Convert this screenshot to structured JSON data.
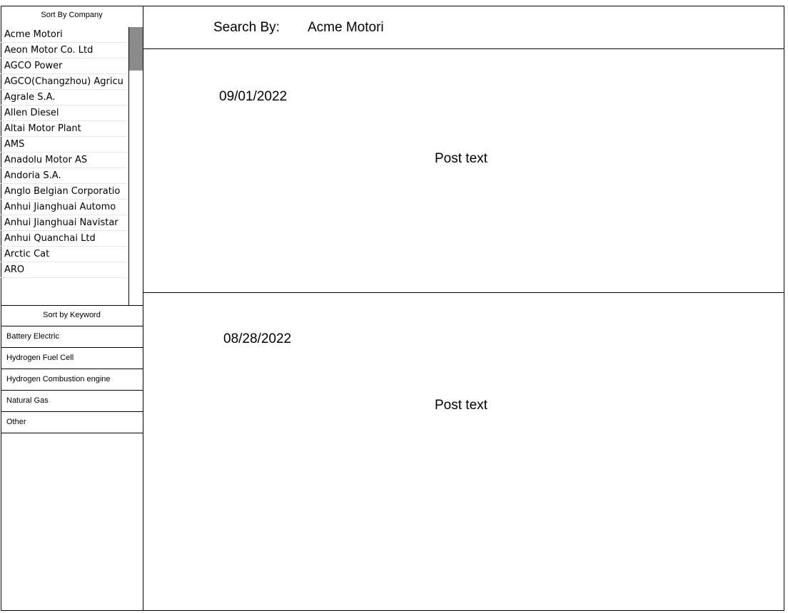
{
  "sidebar": {
    "company_header": "Sort By Company",
    "companies": [
      "Acme Motori",
      "Aeon Motor Co. Ltd",
      "AGCO  Power",
      "AGCO(Changzhou) Agricu",
      "Agrale S.A.",
      "Allen Diesel",
      "Altai Motor Plant",
      "AMS",
      "Anadolu Motor AS",
      "Andoria S.A.",
      "Anglo Belgian Corporatio",
      "Anhui Jianghuai Automo",
      "Anhui Jianghuai Navistar",
      "Anhui Quanchai Ltd",
      "Arctic Cat",
      "ARO"
    ],
    "keyword_header": "Sort by Keyword",
    "keywords": [
      "Battery Electric",
      "Hydrogen Fuel Cell",
      "Hydrogen Combustion engine",
      "Natural Gas",
      "Other"
    ]
  },
  "search": {
    "label": "Search By:",
    "value": "Acme Motori"
  },
  "posts": [
    {
      "date": "09/01/2022",
      "text": "Post text"
    },
    {
      "date": "08/28/2022",
      "text": "Post text"
    }
  ]
}
